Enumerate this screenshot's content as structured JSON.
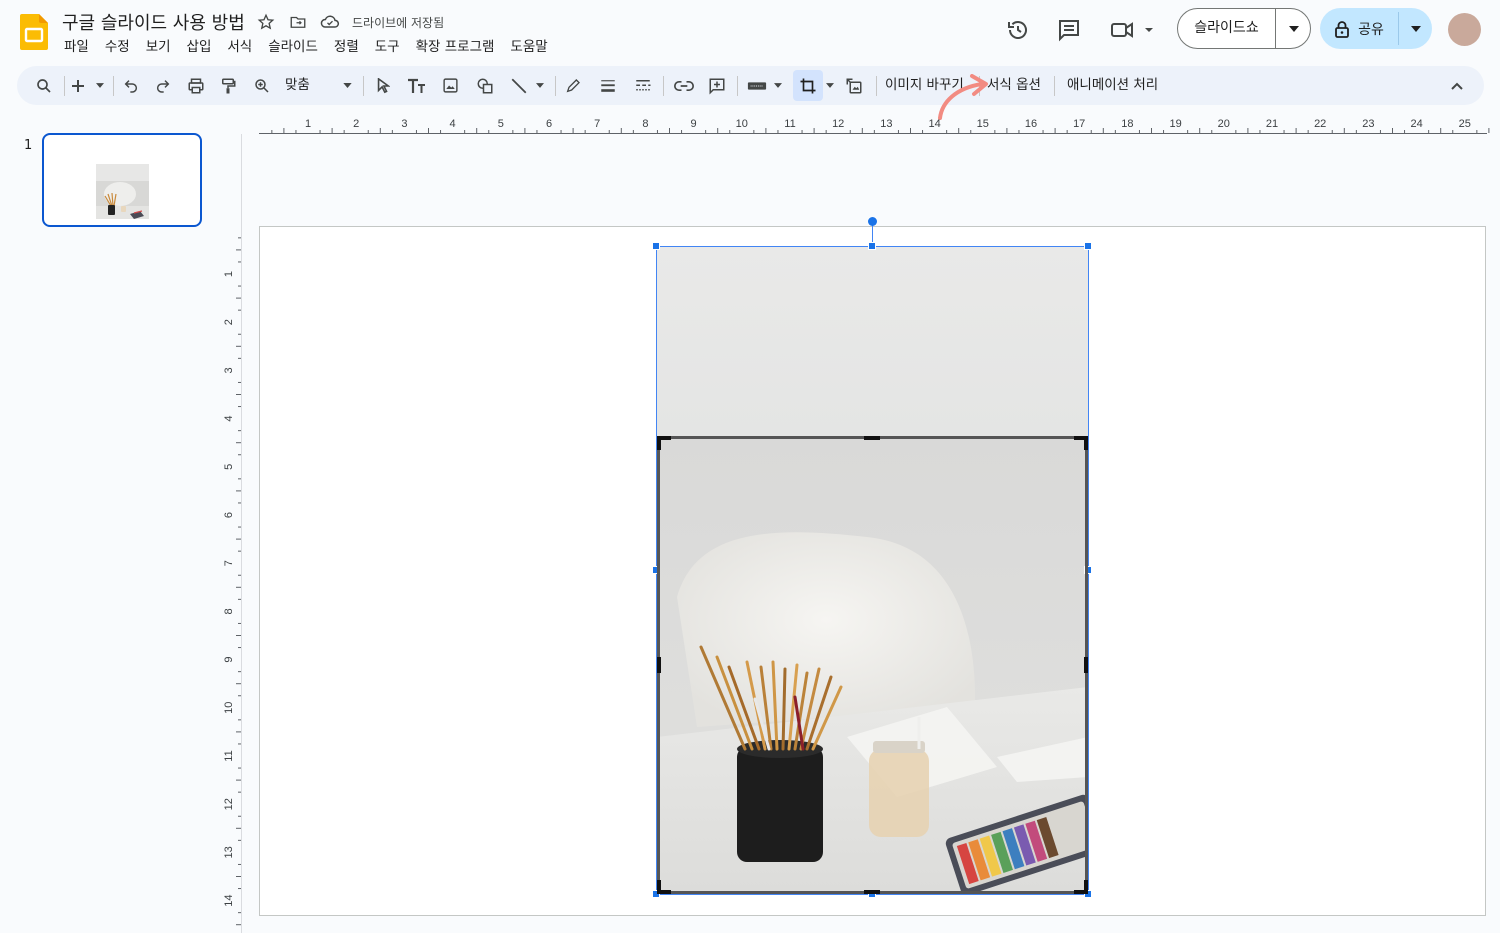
{
  "document": {
    "title": "구글 슬라이드 사용 방법",
    "save_status": "드라이브에 저장됨"
  },
  "menu": [
    "파일",
    "수정",
    "보기",
    "삽입",
    "서식",
    "슬라이드",
    "정렬",
    "도구",
    "확장 프로그램",
    "도움말"
  ],
  "header_right": {
    "slideshow_label": "슬라이드쇼",
    "share_label": "공유"
  },
  "toolbar": {
    "zoom_label": "맞춤",
    "replace_image_label": "이미지 바꾸기",
    "format_options_label": "서식 옵션",
    "animation_label": "애니메이션 처리"
  },
  "ruler": {
    "horizontal_ticks": [
      "1",
      "2",
      "3",
      "4",
      "5",
      "6",
      "7",
      "8",
      "9",
      "10",
      "11",
      "12",
      "13",
      "14",
      "15",
      "16",
      "17",
      "18",
      "19",
      "20",
      "21",
      "22",
      "23",
      "24",
      "25"
    ],
    "vertical_ticks": [
      "1",
      "2",
      "3",
      "4",
      "5",
      "6",
      "7",
      "8",
      "9",
      "10",
      "11",
      "12",
      "13",
      "14"
    ]
  },
  "filmstrip": {
    "slides": [
      {
        "number": "1"
      }
    ]
  },
  "colors": {
    "accent": "#0b57d0",
    "selection": "#1a73e8",
    "share_bg": "#c2e7ff",
    "toolbar_bg": "#edf2fa",
    "annotation": "#f28b82"
  }
}
